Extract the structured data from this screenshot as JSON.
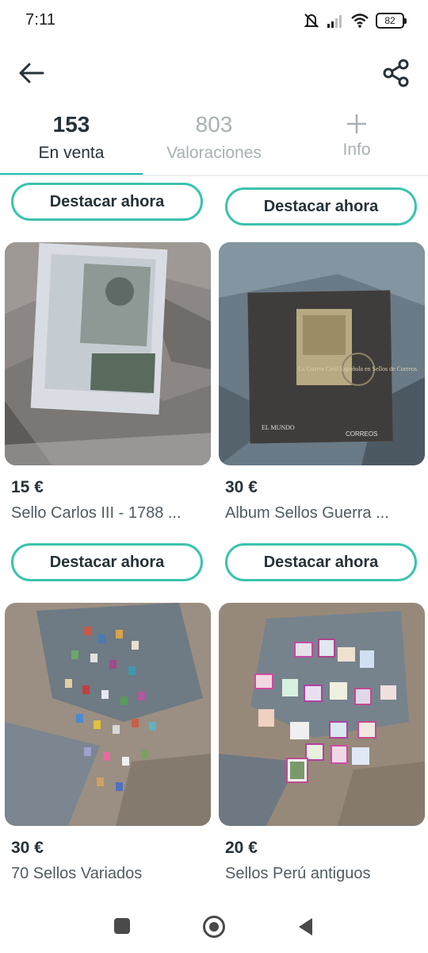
{
  "status_bar": {
    "time": "7:11",
    "battery": "82"
  },
  "header": {
    "back_icon": "arrow-left-icon",
    "share_icon": "share-icon"
  },
  "tabs": [
    {
      "count": "153",
      "label": "En venta",
      "active": true
    },
    {
      "count": "803",
      "label": "Valoraciones",
      "active": false
    },
    {
      "icon": "plus-icon",
      "label": "Info",
      "active": false
    }
  ],
  "accent_color": "#13c1ac",
  "products": [
    {
      "feature_label": "Destacar ahora",
      "price": "",
      "title": ""
    },
    {
      "feature_label": "Destacar ahora",
      "price": "",
      "title": ""
    },
    {
      "feature_label": "Destacar ahora",
      "price": "15 €",
      "title": "Sello Carlos III - 1788 ..."
    },
    {
      "feature_label": "Destacar ahora",
      "price": "30 €",
      "title": "Album Sellos Guerra ..."
    },
    {
      "feature_label": "",
      "price": "30 €",
      "title": "70 Sellos Variados"
    },
    {
      "feature_label": "",
      "price": "20 €",
      "title": "Sellos Perú antiguos"
    }
  ],
  "image_text": {
    "album_title": "La Guerra Civil Española en Sellos de Correos",
    "album_brand_left": "EL MUNDO",
    "album_brand_right": "CORREOS"
  },
  "system_nav": {
    "recents_icon": "square-icon",
    "home_icon": "circle-home-icon",
    "back_icon": "triangle-back-icon"
  }
}
